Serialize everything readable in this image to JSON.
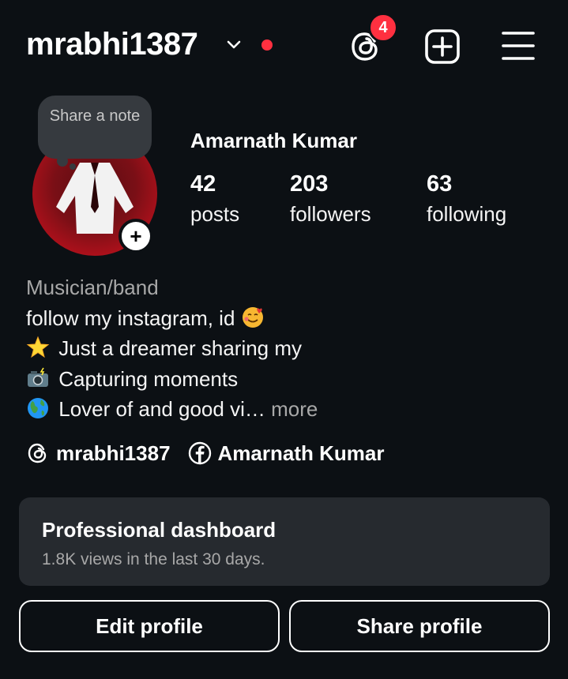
{
  "header": {
    "username": "mrabhi1387",
    "threads_badge_count": "4",
    "icons": [
      "chevron-down-icon",
      "live-dot",
      "threads-icon",
      "add-post-icon",
      "hamburger-menu-icon"
    ],
    "accent_red": "#ff3040"
  },
  "profile": {
    "note_prompt": "Share a note",
    "add_story_symbol": "+",
    "full_name": "Amarnath Kumar",
    "stats": [
      {
        "value": "42",
        "label": "posts"
      },
      {
        "value": "203",
        "label": "followers"
      },
      {
        "value": "63",
        "label": "following"
      }
    ]
  },
  "bio": {
    "category": "Musician/band",
    "lines": [
      {
        "emoji": "smiling-face-with-hearts",
        "text": "follow my instagram, id"
      },
      {
        "emoji": "glowing-star",
        "text": "Just a dreamer sharing my"
      },
      {
        "emoji": "camera-with-flash",
        "text": "Capturing moments"
      },
      {
        "emoji": "globe",
        "text": "Lover of and good vi…"
      }
    ],
    "more_label": "more"
  },
  "links": [
    {
      "icon": "threads-icon",
      "label": "mrabhi1387"
    },
    {
      "icon": "facebook-icon",
      "label": "Amarnath Kumar"
    }
  ],
  "dashboard": {
    "title": "Professional dashboard",
    "subtitle": "1.8K views in the last 30 days."
  },
  "buttons": {
    "edit_profile": "Edit profile",
    "share_profile": "Share profile"
  },
  "colors": {
    "background": "#0c1014",
    "card": "#262a2f",
    "note_bubble": "#363a3f",
    "secondary_text": "#a8a8a8"
  }
}
